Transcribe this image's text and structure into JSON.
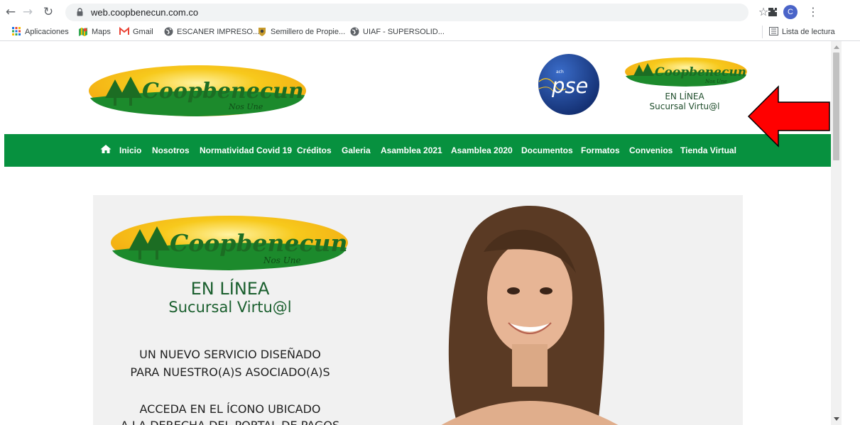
{
  "browser": {
    "url": "web.coopbenecun.com.co",
    "profile_initial": "C",
    "reading_list": "Lista de lectura",
    "bookmarks": [
      {
        "label": "Aplicaciones",
        "icon": "apps-grid-icon"
      },
      {
        "label": "Maps",
        "icon": "maps-icon"
      },
      {
        "label": "Gmail",
        "icon": "gmail-icon"
      },
      {
        "label": "ESCANER IMPRESO...",
        "icon": "globe-icon"
      },
      {
        "label": "Semillero de Propie...",
        "icon": "emblem-icon"
      },
      {
        "label": "UIAF - SUPERSOLID...",
        "icon": "globe-icon"
      }
    ]
  },
  "site": {
    "logo_text": "Coopbenecun",
    "logo_tagline": "Nos Une",
    "pse_label": "pse",
    "pse_small": "ach",
    "virtual_branch": {
      "line1": "EN LÍNEA",
      "line2": "Sucursal Virtu@l"
    },
    "nav": [
      "Inicio",
      "Nosotros",
      "Normatividad Covid 19",
      "Créditos",
      "Galeria",
      "Asamblea 2021",
      "Asamblea 2020",
      "Documentos",
      "Formatos",
      "Convenios",
      "Tienda Virtual"
    ]
  },
  "hero": {
    "headline1": "EN LÍNEA",
    "headline2": "Sucursal Virtu@l",
    "line1": "UN NUEVO SERVICIO DISEÑADO",
    "line2": "PARA NUESTRO(A)S ASOCIADO(A)S",
    "line3": "ACCEDA EN EL ÍCONO UBICADO",
    "line4": "A LA DERECHA DEL PORTAL DE PAGOS"
  },
  "colors": {
    "nav_green": "#07913f",
    "logo_green": "#1c8a2c",
    "logo_yellow": "#f6c21a",
    "pse_blue": "#1d3f8f",
    "arrow_red": "#ff0000"
  }
}
